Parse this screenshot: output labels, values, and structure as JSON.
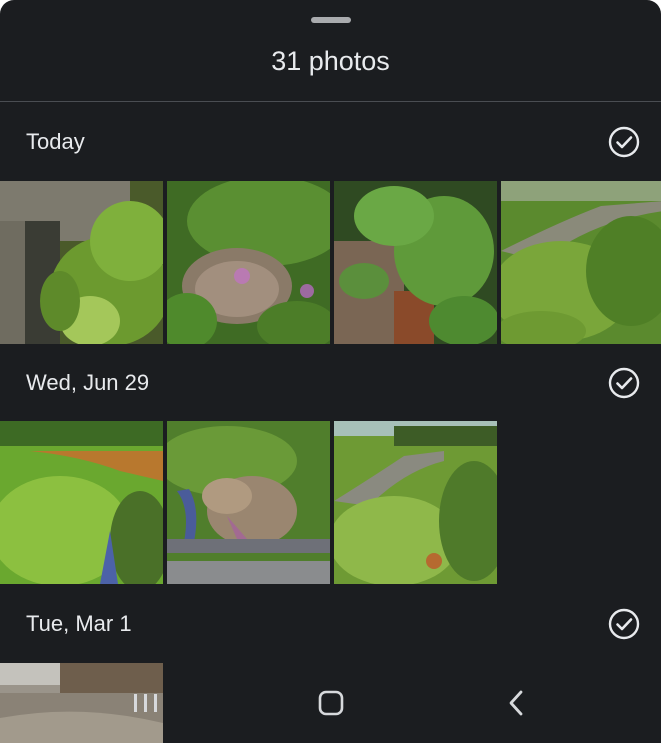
{
  "sheet": {
    "title": "31 photos"
  },
  "sections": [
    {
      "label": "Today",
      "photo_count": 4,
      "thumbs": [
        "culvert with weeds",
        "muddy pond with purple flowers",
        "green plants by concrete",
        "overgrown field with path"
      ]
    },
    {
      "label": "Wed, Jun 29",
      "photo_count": 3,
      "thumbs": [
        "green slope with orange soil",
        "rocky ditch with pipe",
        "grassy field with gravel path"
      ]
    },
    {
      "label": "Tue, Mar 1",
      "photo_count": 1,
      "thumbs": [
        "dry field with bare trees"
      ]
    }
  ],
  "icons": {
    "select_all": "check-circle-icon",
    "recents": "recents-icon",
    "home": "home-icon",
    "back": "back-icon"
  },
  "colors": {
    "background": "#1b1d20",
    "text": "#e8eaed",
    "divider": "#4a4d52"
  }
}
